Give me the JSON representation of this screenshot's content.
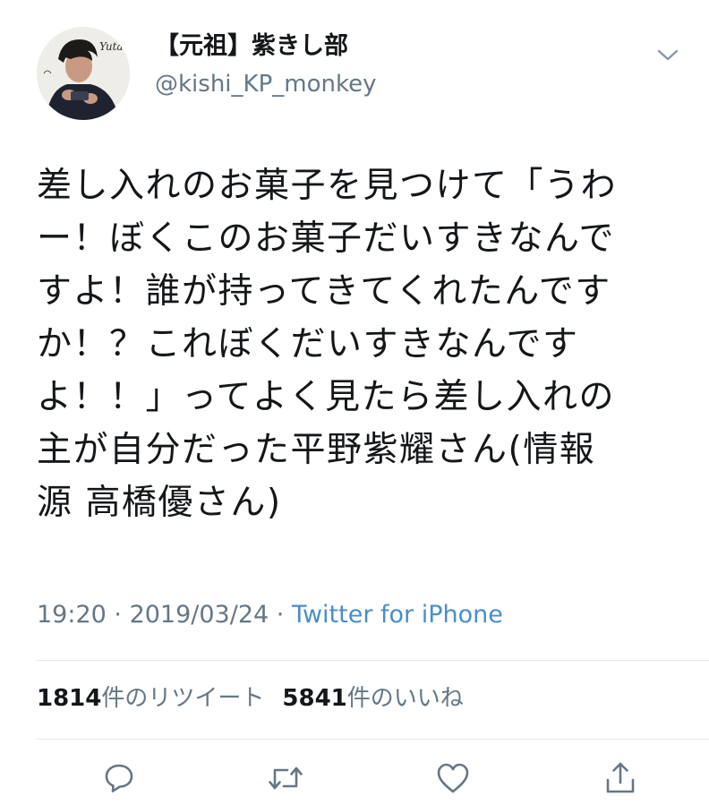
{
  "user": {
    "display_name": "【元祖】紫きし部",
    "handle": "@kishi_KP_monkey",
    "avatar_text": "Yuta"
  },
  "tweet": {
    "lines": [
      "差し入れのお菓子を見つけて「うわ",
      "ー！ぼくこのお菓子だいすきなんで",
      "すよ！誰が持ってきてくれたんです",
      "か！？これぼくだいすきなんです",
      "よ！！」ってよく見たら差し入れの",
      "主が自分だった平野紫耀さん(情報",
      "源 高橋優さん)"
    ]
  },
  "meta": {
    "time": "19:20",
    "separator1": " · ",
    "date": "2019/03/24",
    "separator2": " · ",
    "source": "Twitter for iPhone"
  },
  "stats": {
    "retweets_count": "1814",
    "retweets_label": "件のリツイート",
    "likes_count": "5841",
    "likes_label": "件のいいね"
  },
  "icons": {
    "chevron": "chevron-down-icon",
    "reply": "reply-icon",
    "retweet": "retweet-icon",
    "like": "heart-icon",
    "share": "share-icon"
  },
  "colors": {
    "text": "#14171a",
    "secondary": "#657786",
    "link": "#4a8ec9",
    "divider": "#e1e8ed"
  }
}
